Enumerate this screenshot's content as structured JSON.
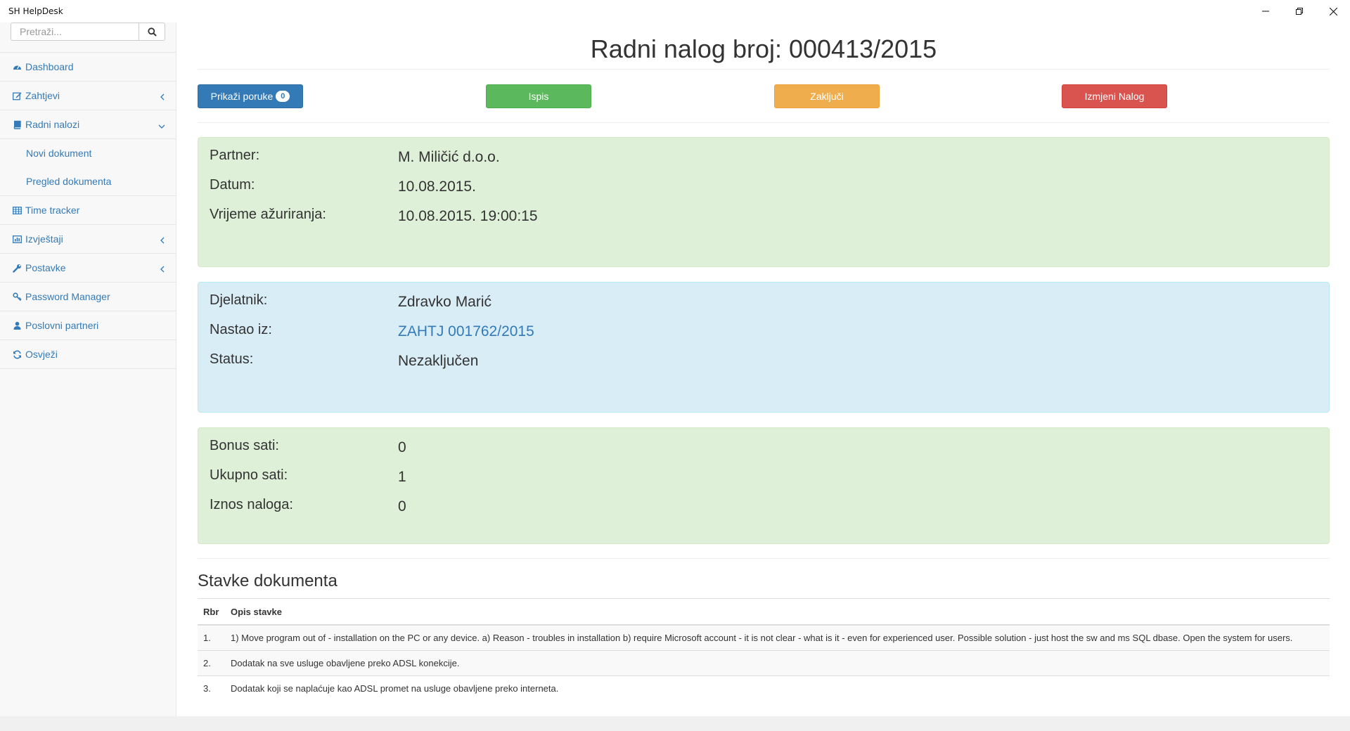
{
  "window": {
    "title": "SH HelpDesk"
  },
  "sidebar": {
    "search_placeholder": "Pretraži...",
    "items": [
      {
        "label": "Dashboard",
        "icon": "dashboard-icon"
      },
      {
        "label": "Zahtjevi",
        "icon": "edit-icon",
        "chevron": "left"
      },
      {
        "label": "Radni nalozi",
        "icon": "book-icon",
        "chevron": "down"
      },
      {
        "label": "Time tracker",
        "icon": "table-icon"
      },
      {
        "label": "Izvještaji",
        "icon": "bar-chart-icon",
        "chevron": "left"
      },
      {
        "label": "Postavke",
        "icon": "wrench-icon",
        "chevron": "left"
      },
      {
        "label": "Password Manager",
        "icon": "key-icon"
      },
      {
        "label": "Poslovni partneri",
        "icon": "user-icon"
      },
      {
        "label": "Osvježi",
        "icon": "refresh-icon"
      }
    ],
    "sub_items": [
      {
        "label": "Novi dokument"
      },
      {
        "label": "Pregled dokumenta"
      }
    ]
  },
  "main": {
    "title": "Radni nalog broj: 000413/2015",
    "buttons": {
      "messages_label": "Prikaži poruke",
      "messages_count": "0",
      "print_label": "Ispis",
      "close_label": "Zaključi",
      "edit_label": "Izmjeni Nalog"
    },
    "info": {
      "partner_label": "Partner:",
      "partner_value": "M. Miličić d.o.o.",
      "date_label": "Datum:",
      "date_value": "10.08.2015.",
      "updated_label": "Vrijeme ažuriranja:",
      "updated_value": "10.08.2015. 19:00:15"
    },
    "worker": {
      "worker_label": "Djelatnik:",
      "worker_value": "Zdravko Marić",
      "origin_label": "Nastao iz:",
      "origin_value": "ZAHTJ 001762/2015",
      "status_label": "Status:",
      "status_value": "Nezaključen"
    },
    "hours": {
      "bonus_label": "Bonus sati:",
      "bonus_value": "0",
      "total_label": "Ukupno sati:",
      "total_value": "1",
      "amount_label": "Iznos naloga:",
      "amount_value": "0"
    },
    "items_section": {
      "title": "Stavke dokumenta",
      "columns": [
        "Rbr",
        "Opis stavke"
      ],
      "rows": [
        {
          "rbr": "1.",
          "opis": "1) Move program out of - installation on the PC or any device. a) Reason - troubles in installation b) require Microsoft account - it is not clear - what is it - even for experienced user. Possible solution - just host the sw and ms SQL dbase. Open the system for users."
        },
        {
          "rbr": "2.",
          "opis": "Dodatak na sve usluge obavljene preko ADSL konekcije."
        },
        {
          "rbr": "3.",
          "opis": "Dodatak koji se naplaćuje kao ADSL promet na usluge obavljene preko interneta."
        }
      ]
    }
  },
  "colors": {
    "link": "#337ab7",
    "panel_green": "#dff0d8",
    "panel_blue": "#d9edf7",
    "btn_primary": "#337ab7",
    "btn_success": "#5cb85c",
    "btn_warning": "#f0ad4e",
    "btn_danger": "#d9534f"
  }
}
